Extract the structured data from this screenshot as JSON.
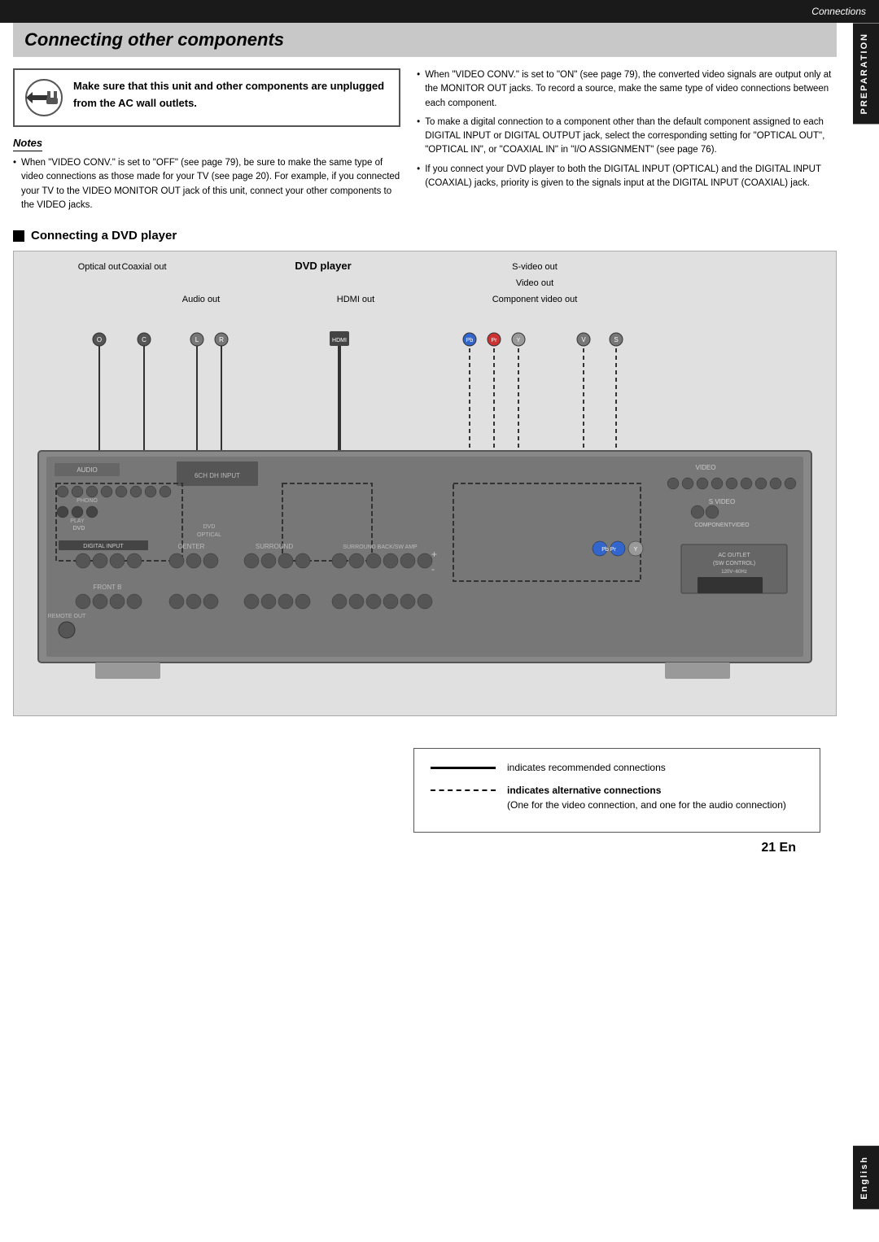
{
  "page": {
    "top_bar_label": "Connections",
    "right_tab_label": "PREPARATION",
    "right_tab_english": "English",
    "page_number": "21 En"
  },
  "title": "Connecting other components",
  "warning": {
    "text": "Make sure that this unit and other components are unplugged from the AC wall outlets."
  },
  "notes": {
    "title": "Notes",
    "items": [
      "When \"VIDEO CONV.\" is set to \"OFF\" (see page 79), be sure to make the same type of video connections as those made for your TV (see page 20). For example, if you connected your TV to the VIDEO MONITOR OUT jack of this unit, connect your other components to the VIDEO jacks.",
      "When \"VIDEO CONV.\" is set to \"ON\" (see page 79), the converted video signals are output only at the MONITOR OUT jacks. To record a source, make the same type of video connections between each component.",
      "To make a digital connection to a component other than the default component assigned to each DIGITAL INPUT or DIGITAL OUTPUT jack, select the corresponding setting for \"OPTICAL OUT\", \"OPTICAL IN\", or \"COAXIAL IN\" in \"I/O ASSIGNMENT\" (see page 76).",
      "If you connect your DVD player to both the DIGITAL INPUT (OPTICAL) and the DIGITAL INPUT (COAXIAL) jacks, priority is given to the signals input at the DIGITAL INPUT (COAXIAL) jack."
    ]
  },
  "section": {
    "heading": "Connecting a DVD player"
  },
  "diagram": {
    "dvd_player_label": "DVD player",
    "labels": [
      "Optical out",
      "Coaxial out",
      "Audio out",
      "HDMI out",
      "S-video out",
      "Video out",
      "Component video out"
    ]
  },
  "legend": {
    "solid_line_label": "indicates recommended connections",
    "dashed_line_label": "indicates alternative connections",
    "dashed_line_sub": "(One for the video connection, and one for the audio connection)"
  }
}
